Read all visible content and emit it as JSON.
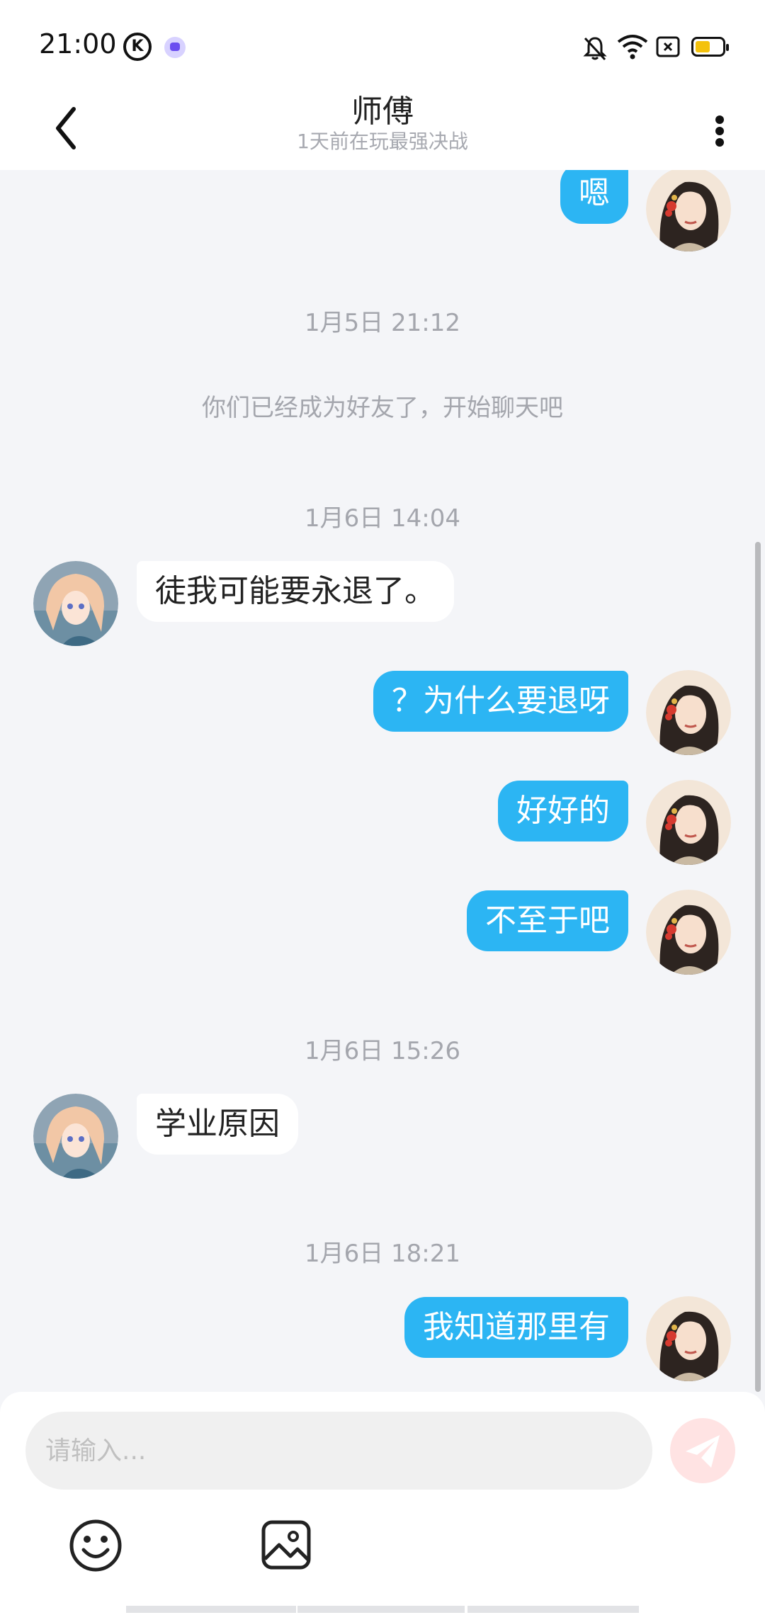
{
  "status_bar": {
    "time": "21:00",
    "icons": [
      "k-app-icon",
      "messenger-icon",
      "mute-icon",
      "wifi-icon",
      "sim-icon",
      "battery-icon"
    ],
    "battery_color": "#f4c20d"
  },
  "header": {
    "title": "师傅",
    "subtitle": "1天前在玩最强决战"
  },
  "chat": {
    "sent_color": "#2cb5f3",
    "messages": [
      {
        "type": "sent",
        "text": "嗯"
      },
      {
        "type": "timestamp",
        "text": "1月5日 21:12"
      },
      {
        "type": "system",
        "text": "你们已经成为好友了，开始聊天吧"
      },
      {
        "type": "timestamp",
        "text": "1月6日 14:04"
      },
      {
        "type": "received",
        "text": "徒我可能要永退了。"
      },
      {
        "type": "sent",
        "text": "？为什么要退呀"
      },
      {
        "type": "sent",
        "text": "好好的"
      },
      {
        "type": "sent",
        "text": "不至于吧"
      },
      {
        "type": "timestamp",
        "text": "1月6日 15:26"
      },
      {
        "type": "received",
        "text": "学业原因"
      },
      {
        "type": "timestamp",
        "text": "1月6日 18:21"
      },
      {
        "type": "sent",
        "text": "我知道那里有"
      }
    ]
  },
  "input": {
    "placeholder": "请输入...",
    "value": ""
  },
  "toolbar": {
    "icons": [
      "emoji-icon",
      "image-icon",
      "send-icon"
    ]
  }
}
